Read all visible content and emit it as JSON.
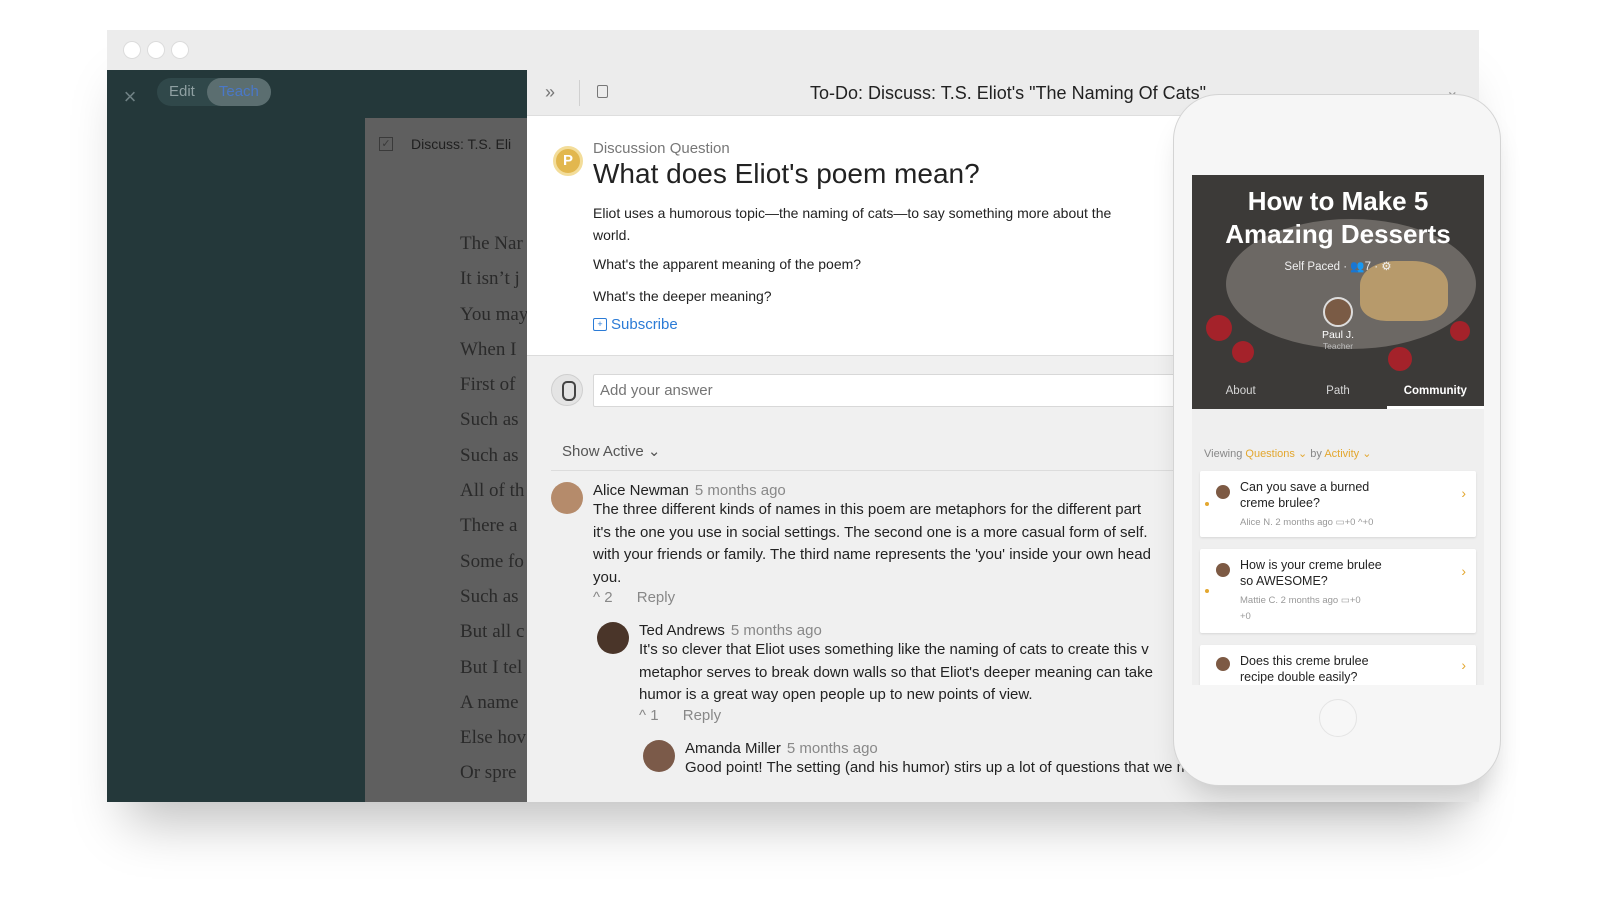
{
  "window": {
    "left_panel": {
      "mode_tabs": [
        "Edit",
        "Teach"
      ],
      "active_mode": "Teach",
      "card_title": "Discuss: T.S. Eli",
      "poem_lines": [
        "The Nar",
        "It isn’t j",
        "You may",
        "When I",
        "First of",
        "Such as",
        "Such as",
        "All of th",
        "There a",
        "Some fo",
        "Such as",
        "But all c",
        "But I tel",
        "A name",
        "Else hov",
        "Or spre"
      ]
    },
    "detail": {
      "title": "To-Do: Discuss: T.S. Eliot's \"The Naming Of Cats\"",
      "question": {
        "kicker": "Discussion Question",
        "title": "What does Eliot's poem mean?",
        "body": "Eliot uses a humorous topic—the naming of cats—to say something more about the world.",
        "line2": "What's the apparent meaning of the poem?",
        "line3": "What's the deeper meaning?",
        "subscribe": "Subscribe"
      },
      "answer_placeholder": "Add your answer",
      "filter": "Show Active",
      "comments": [
        {
          "author": "Alice Newman",
          "time": "5 months ago",
          "lines": [
            "The three different kinds of names in this poem are metaphors for the different part",
            "it's the one you use in social settings. The second one is a more casual form of self.",
            "with your friends or family. The third name represents the 'you' inside your own head",
            "you."
          ],
          "votes": "2",
          "reply": "Reply"
        },
        {
          "author": "Ted Andrews",
          "time": "5 months ago",
          "lines": [
            "It's so clever that Eliot uses something like the naming of cats to create this v",
            "metaphor serves to break down walls so that Eliot's deeper meaning can take",
            "humor is a great way open people up to new points of view."
          ],
          "votes": "1",
          "reply": "Reply"
        },
        {
          "author": "Amanda Miller",
          "time": "5 months ago",
          "lines": [
            "Good point! The setting (and his humor) stirs up a lot of questions that we might not ask if he'd written about"
          ]
        }
      ]
    }
  },
  "phone": {
    "hero": {
      "title_line1": "How to Make 5",
      "title_line2": "Amazing Desserts",
      "pace": "Self Paced",
      "members": "7",
      "teacher_name": "Paul J.",
      "teacher_role": "Teacher",
      "tabs": [
        "About",
        "Path",
        "Community"
      ],
      "active_tab": "Community"
    },
    "viewing": {
      "label": "Viewing",
      "type": "Questions",
      "by": "by",
      "sort": "Activity"
    },
    "questions": [
      {
        "title_line1": "Can you save a burned",
        "title_line2": "creme brulee?",
        "meta": "Alice N.   2 months ago",
        "count_a": "+0",
        "count_b": "+0"
      },
      {
        "title_line1": "How is your creme brulee",
        "title_line2": "so AWESOME?",
        "meta": "Mattie C.   2 months ago",
        "count_a": "+0",
        "count_b": "+0"
      },
      {
        "title_line1": "Does this creme brulee",
        "title_line2": "recipe double easily?"
      }
    ]
  }
}
